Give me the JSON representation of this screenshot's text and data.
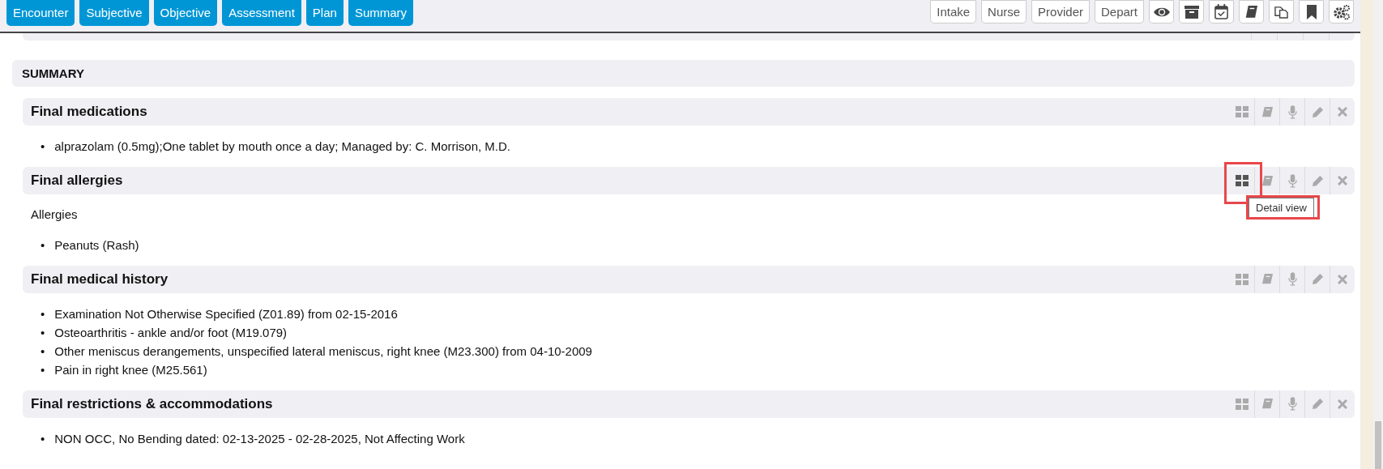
{
  "nav_tabs": [
    {
      "label": "Encounter"
    },
    {
      "label": "Subjective"
    },
    {
      "label": "Objective"
    },
    {
      "label": "Assessment"
    },
    {
      "label": "Plan"
    },
    {
      "label": "Summary"
    }
  ],
  "workflow_buttons": [
    {
      "label": "Intake"
    },
    {
      "label": "Nurse"
    },
    {
      "label": "Provider"
    },
    {
      "label": "Depart"
    }
  ],
  "summary": {
    "title": "SUMMARY",
    "bullet": "•",
    "sections": [
      {
        "title": "Final medications",
        "highlighted": false,
        "items": [
          "alprazolam (0.5mg);One tablet by mouth once a day; Managed by: C. Morrison, M.D."
        ]
      },
      {
        "title": "Final allergies",
        "highlighted": true,
        "tooltip": "Detail view",
        "subtitle": "Allergies",
        "items": [
          "Peanuts (Rash)"
        ]
      },
      {
        "title": "Final medical history",
        "highlighted": false,
        "items": [
          "Examination Not Otherwise Specified (Z01.89) from 02-15-2016",
          "Osteoarthritis - ankle and/or foot (M19.079)",
          "Other meniscus derangements, unspecified lateral meniscus, right knee (M23.300) from 04-10-2009",
          "Pain in right knee (M25.561)"
        ]
      },
      {
        "title": "Final restrictions & accommodations",
        "highlighted": false,
        "items": [
          "NON OCC, No Bending dated: 02-13-2025 - 02-28-2025, Not Affecting Work"
        ]
      }
    ]
  }
}
